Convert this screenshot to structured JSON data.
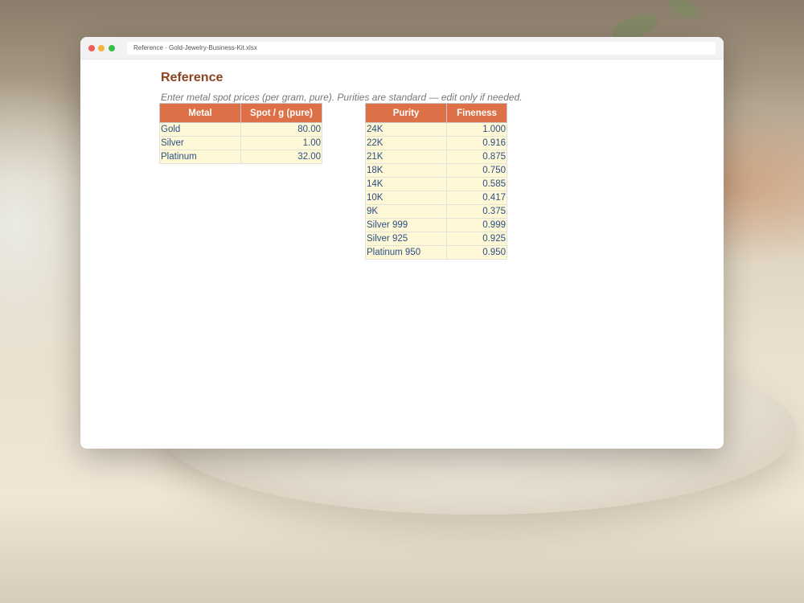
{
  "window": {
    "tab_title": "Reference · Gold-Jewelry-Business-Kit.xlsx"
  },
  "sheet": {
    "title": "Reference",
    "note": "Enter metal spot prices (per gram, pure). Purities are standard — edit only if needed.",
    "metals_table": {
      "headers": [
        "Metal",
        "Spot / g (pure)"
      ],
      "rows": [
        [
          "Gold",
          "80.00"
        ],
        [
          "Silver",
          "1.00"
        ],
        [
          "Platinum",
          "32.00"
        ]
      ]
    },
    "purity_table": {
      "headers": [
        "Purity",
        "Fineness"
      ],
      "rows": [
        [
          "24K",
          "1.000"
        ],
        [
          "22K",
          "0.916"
        ],
        [
          "21K",
          "0.875"
        ],
        [
          "18K",
          "0.750"
        ],
        [
          "14K",
          "0.585"
        ],
        [
          "10K",
          "0.417"
        ],
        [
          "9K",
          "0.375"
        ],
        [
          "Silver 999",
          "0.999"
        ],
        [
          "Silver 925",
          "0.925"
        ],
        [
          "Platinum 950",
          "0.950"
        ]
      ]
    }
  },
  "colors": {
    "header_fill": "#dd7047",
    "cell_fill": "#fff8d6",
    "title_text": "#8b4421",
    "value_text": "#2a4f86"
  }
}
